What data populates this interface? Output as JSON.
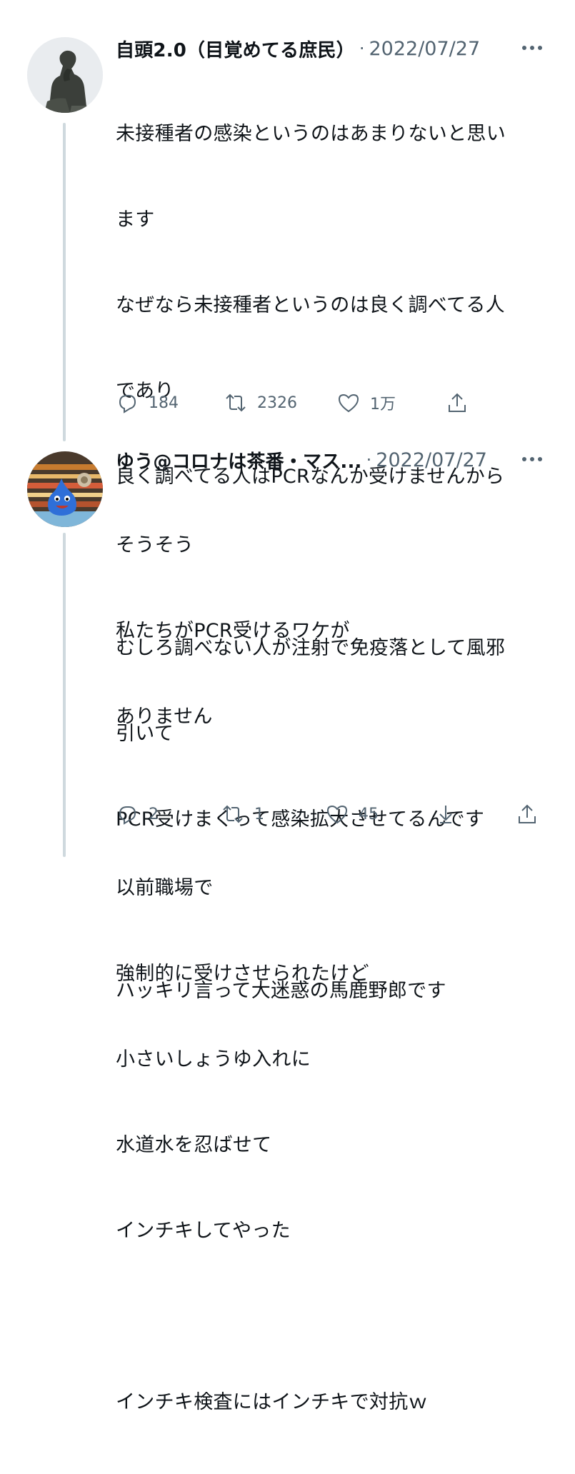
{
  "tweets": [
    {
      "name": "自頭2.0（目覚めてる庶民）",
      "separator": "·",
      "date": "2022/07/27",
      "lines": [
        "未接種者の感染というのはあまりないと思い",
        "ます",
        "なぜなら未接種者というのは良く調べてる人",
        "であり",
        "良く調べてる人はPCRなんか受けませんから",
        "",
        "むしろ調べない人が注射で免疫落として風邪",
        "引いて",
        "PCR受けまくって感染拡大させてるんです",
        "",
        "ハッキリ言って大迷惑の馬鹿野郎です"
      ],
      "actions": {
        "reply_icon": "reply-icon",
        "reply_count": "184",
        "retweet_icon": "retweet-icon",
        "retweet_count": "2326",
        "like_icon": "heart-icon",
        "like_count": "1万",
        "share_icon": "share-icon"
      }
    },
    {
      "name": "ゆう@コロナは茶番・マス...",
      "separator": "·",
      "date": "2022/07/27",
      "lines": [
        "そうそう",
        "私たちがPCR受けるワケが",
        "ありません",
        "",
        "以前職場で",
        "強制的に受けさせられたけど",
        "小さいしょうゆ入れに",
        "水道水を忍ばせて",
        "インチキしてやった",
        "",
        "インチキ検査にはインチキで対抗ｗ"
      ],
      "actions": {
        "reply_icon": "reply-icon",
        "reply_count": "2",
        "retweet_icon": "retweet-icon",
        "retweet_count": "1",
        "like_icon": "heart-icon",
        "like_count": "45",
        "download_icon": "download-icon",
        "share_icon": "share-icon"
      }
    }
  ],
  "colors": {
    "text": "#0f1419",
    "secondary": "#536471",
    "thread_line": "#cfd9de"
  }
}
